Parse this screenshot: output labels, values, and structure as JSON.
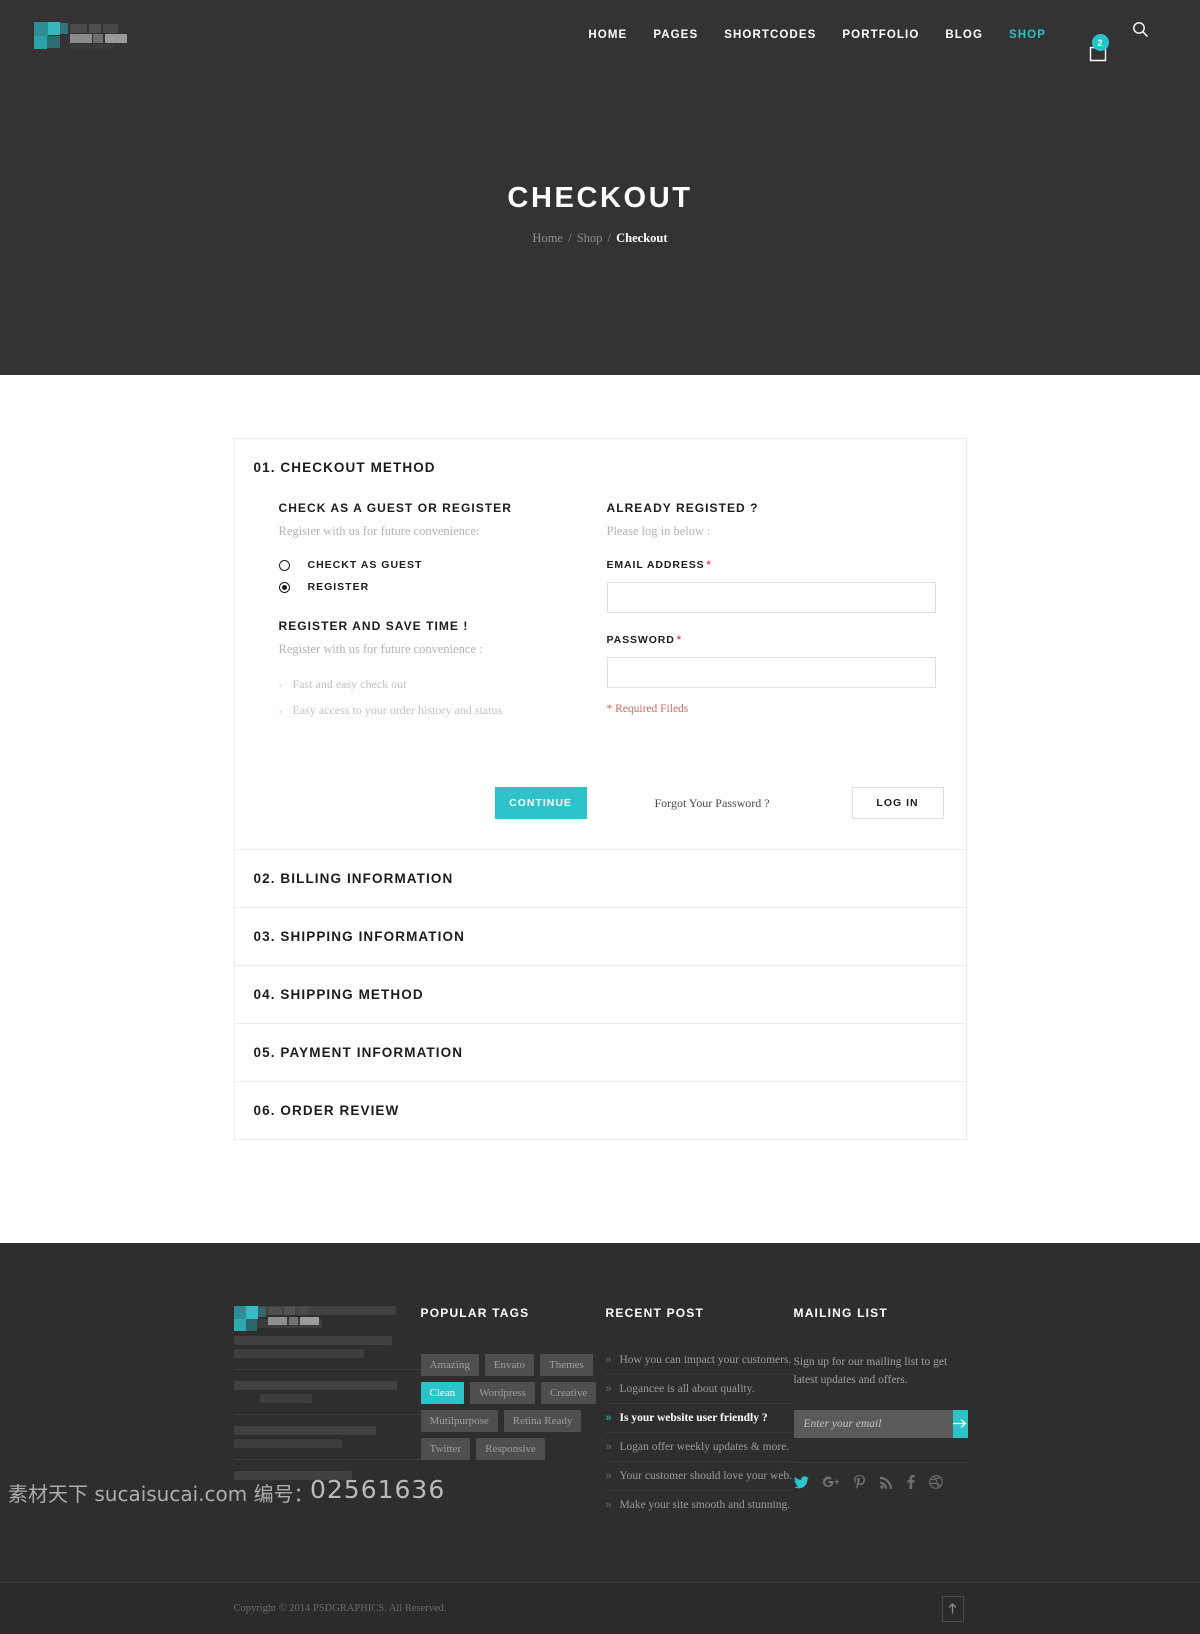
{
  "header": {
    "logo_alt": "site-logo",
    "nav": [
      {
        "label": "HOME",
        "active": false
      },
      {
        "label": "PAGES",
        "active": false
      },
      {
        "label": "SHORTCODES",
        "active": false
      },
      {
        "label": "PORTFOLIO",
        "active": false
      },
      {
        "label": "BLOG",
        "active": false
      },
      {
        "label": "SHOP",
        "active": true
      }
    ],
    "cart_icon": "shopping-bag-icon",
    "cart_count": "2",
    "search_icon": "search-icon"
  },
  "hero": {
    "title": "CHECKOUT",
    "breadcrumb": {
      "home": "Home",
      "shop": "Shop",
      "current": "Checkout",
      "separator": "/"
    }
  },
  "checkout": {
    "step1": {
      "heading": "01. CHECKOUT METHOD",
      "guest": {
        "title": "CHECK AS A GUEST OR REGISTER",
        "desc": "Register with us for future convenience:",
        "options": [
          {
            "label": "CHECKT AS GUEST",
            "selected": false
          },
          {
            "label": "REGISTER",
            "selected": true
          }
        ]
      },
      "register": {
        "title": "REGISTER AND SAVE TIME !",
        "desc": "Register with us for future convenience :",
        "benefits": [
          "Fast and easy check out",
          "Easy access to your order history and status"
        ]
      },
      "login": {
        "title": "ALREADY REGISTED ?",
        "desc": "Please log in below :",
        "email_label": "EMAIL ADDRESS",
        "email_value": "",
        "password_label": "PASSWORD",
        "password_value": "",
        "required_marker": "*",
        "required_note": "* Required Fileds",
        "forgot_label": "Forgot Your Password ?",
        "login_button": "LOG IN"
      },
      "continue_button": "CONTINUE"
    },
    "steps": [
      {
        "heading": "02. BILLING INFORMATION"
      },
      {
        "heading": "03. SHIPPING INFORMATION"
      },
      {
        "heading": "04. SHIPPING METHOD"
      },
      {
        "heading": "05. PAYMENT INFORMATION"
      },
      {
        "heading": "06. ORDER REVIEW"
      }
    ]
  },
  "footer": {
    "tags": {
      "heading": "POPULAR TAGS",
      "items": [
        {
          "label": "Amazing",
          "active": false
        },
        {
          "label": "Envato",
          "active": false
        },
        {
          "label": "Themes",
          "active": false
        },
        {
          "label": "Clean",
          "active": true
        },
        {
          "label": "Wordpress",
          "active": false
        },
        {
          "label": "Creative",
          "active": false
        },
        {
          "label": "Mutilpurpose",
          "active": false
        },
        {
          "label": "Retina Ready",
          "active": false
        },
        {
          "label": "Twitter",
          "active": false
        },
        {
          "label": "Responsive",
          "active": false
        }
      ]
    },
    "recent": {
      "heading": "RECENT POST",
      "items": [
        {
          "label": "How you can impact your customers.",
          "active": false
        },
        {
          "label": "Logancee is all about quality.",
          "active": false
        },
        {
          "label": "Is your website user friendly ?",
          "active": true
        },
        {
          "label": "Logan offer weekly updates & more.",
          "active": false
        },
        {
          "label": "Your customer should love your web.",
          "active": false
        },
        {
          "label": "Make your site smooth and stunning.",
          "active": false
        }
      ],
      "bullet": "»"
    },
    "mailing": {
      "heading": "MAILING LIST",
      "desc": "Sign up for our mailing list to get latest updates and offers.",
      "placeholder": "Enter your email",
      "value": "",
      "submit_icon": "arrow-right-icon",
      "socials": [
        {
          "name": "twitter-icon",
          "glyph": "✒",
          "active": true
        },
        {
          "name": "google-plus-icon",
          "glyph": "g⁺",
          "active": false
        },
        {
          "name": "pinterest-icon",
          "glyph": "ᵌ5",
          "active": false
        },
        {
          "name": "rss-icon",
          "glyph": "◔",
          "active": false
        },
        {
          "name": "facebook-icon",
          "glyph": "f",
          "active": false
        },
        {
          "name": "dribbble-icon",
          "glyph": "⊛",
          "active": false
        }
      ]
    },
    "bottom": {
      "copyright": "Copyright © 2014 PSDGRAPHICS. All Reserved.",
      "to_top_icon": "arrow-up-icon"
    }
  },
  "watermark": {
    "site": "素材天下 sucaisucai.com 编号：",
    "number": "02561636"
  },
  "colors": {
    "accent": "#2cc3ca",
    "dark": "#333333",
    "footer_bg": "#2e2e2e",
    "required": "#d9544f"
  }
}
